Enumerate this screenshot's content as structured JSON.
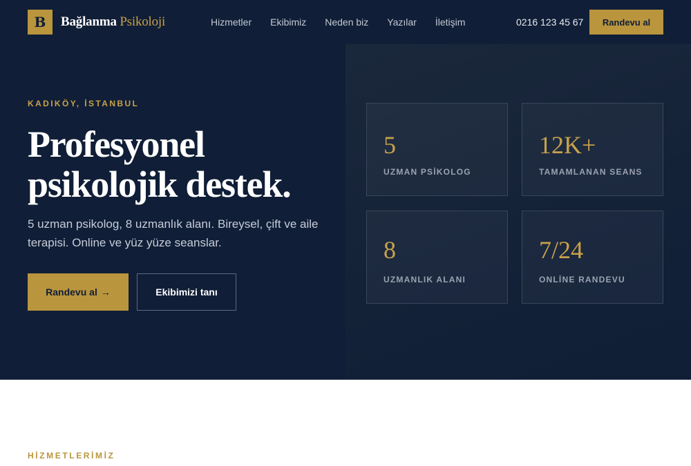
{
  "brand": {
    "logo_letter": "B",
    "name_a": "Bağlanma",
    "name_b": "Psikoloji"
  },
  "nav": {
    "links": [
      "Hizmetler",
      "Ekibimiz",
      "Neden biz",
      "Yazılar",
      "İletişim"
    ],
    "phone": "0216 123 45 67",
    "cta": "Randevu al"
  },
  "hero": {
    "eyebrow": "KADIKÖY, İSTANBUL",
    "headline_line1": "Profesyonel",
    "headline_line2": "psikolojik destek.",
    "lead": "5 uzman psikolog, 8 uzmanlık alanı. Bireysel, çift ve aile terapisi. Online ve yüz yüze seanslar.",
    "primary_button": "Randevu al",
    "primary_arrow": "→",
    "secondary_button": "Ekibimizi tanı"
  },
  "stats": [
    {
      "value": "5",
      "label": "UZMAN PSİKOLOG"
    },
    {
      "value": "12K+",
      "label": "TAMAMLANAN SEANS"
    },
    {
      "value": "8",
      "label": "UZMANLIK ALANI"
    },
    {
      "value": "7/24",
      "label": "ONLİNE RANDEVU"
    }
  ],
  "services": {
    "eyebrow": "HİZMETLERİMİZ"
  },
  "colors": {
    "navy": "#101e37",
    "gold": "#b9953d",
    "gold_text": "#c9a24a"
  }
}
